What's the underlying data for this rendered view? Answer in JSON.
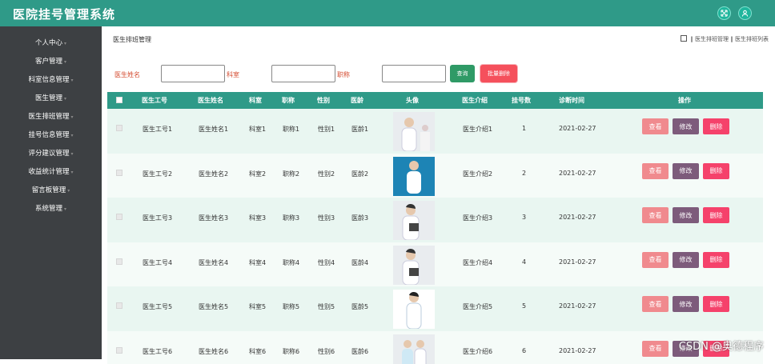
{
  "header": {
    "title": "医院挂号管理系统"
  },
  "sidebar": {
    "items": [
      {
        "label": "个人中心"
      },
      {
        "label": "客户管理"
      },
      {
        "label": "科室信息管理"
      },
      {
        "label": "医生管理"
      },
      {
        "label": "医生排班管理"
      },
      {
        "label": "挂号信息管理"
      },
      {
        "label": "评分建议管理"
      },
      {
        "label": "收益统计管理"
      },
      {
        "label": "留言板管理"
      },
      {
        "label": "系统管理"
      }
    ]
  },
  "page": {
    "title": "医生排班管理",
    "crumb_parent": "医生排班管理",
    "crumb_current": "医生排班列表"
  },
  "filters": {
    "doctor_name_label": "医生姓名",
    "department_label": "科室",
    "title_label": "职称",
    "search_btn": "查询",
    "batch_delete_btn": "批量删除"
  },
  "table": {
    "headers": [
      "医生工号",
      "医生姓名",
      "科室",
      "职称",
      "性别",
      "医龄",
      "头像",
      "医生介绍",
      "挂号数",
      "诊断时间",
      "操作"
    ],
    "rows": [
      {
        "id": "医生工号1",
        "name": "医生姓名1",
        "dept": "科室1",
        "title": "职称1",
        "gender": "性别1",
        "age": "医龄1",
        "intro": "医生介绍1",
        "count": "1",
        "date": "2021-02-27"
      },
      {
        "id": "医生工号2",
        "name": "医生姓名2",
        "dept": "科室2",
        "title": "职称2",
        "gender": "性别2",
        "age": "医龄2",
        "intro": "医生介绍2",
        "count": "2",
        "date": "2021-02-27"
      },
      {
        "id": "医生工号3",
        "name": "医生姓名3",
        "dept": "科室3",
        "title": "职称3",
        "gender": "性别3",
        "age": "医龄3",
        "intro": "医生介绍3",
        "count": "3",
        "date": "2021-02-27"
      },
      {
        "id": "医生工号4",
        "name": "医生姓名4",
        "dept": "科室4",
        "title": "职称4",
        "gender": "性别4",
        "age": "医龄4",
        "intro": "医生介绍4",
        "count": "4",
        "date": "2021-02-27"
      },
      {
        "id": "医生工号5",
        "name": "医生姓名5",
        "dept": "科室5",
        "title": "职称5",
        "gender": "性别5",
        "age": "医龄5",
        "intro": "医生介绍5",
        "count": "5",
        "date": "2021-02-27"
      },
      {
        "id": "医生工号6",
        "name": "医生姓名6",
        "dept": "科室6",
        "title": "职称6",
        "gender": "性别6",
        "age": "医龄6",
        "intro": "医生介绍6",
        "count": "6",
        "date": "2021-02-27"
      }
    ],
    "actions": {
      "view": "查看",
      "edit": "修改",
      "delete": "删除"
    }
  },
  "watermark": "CSDN @奥德程序",
  "colors": {
    "topbar": "#2f9a88",
    "sidebar": "#3d4043",
    "table_header": "#2f9a88",
    "search": "#2f9a66",
    "danger": "#f5426b"
  }
}
